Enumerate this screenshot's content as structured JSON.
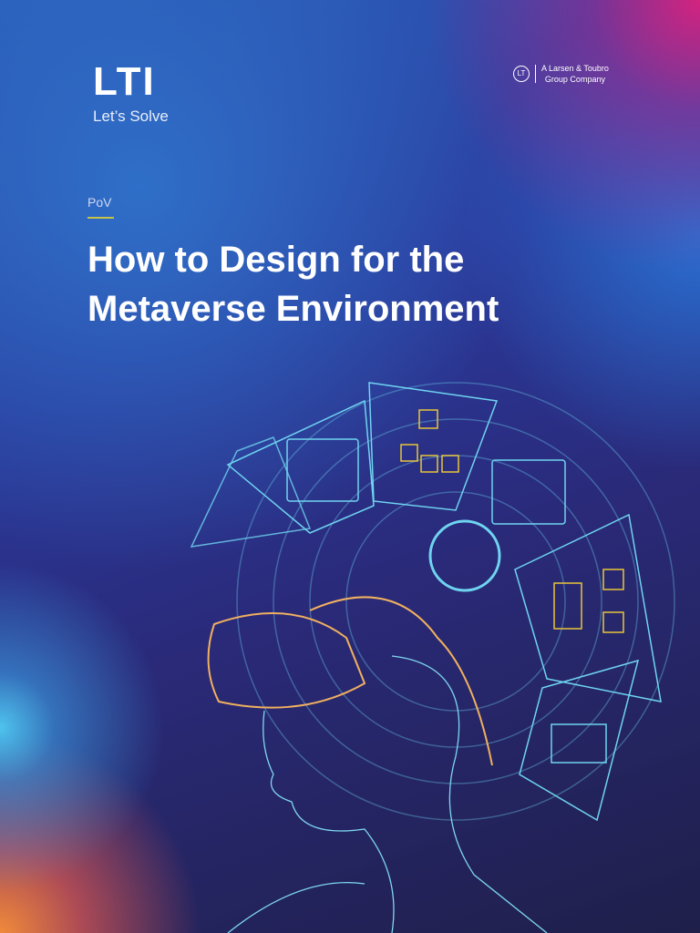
{
  "brand": {
    "logo": "LTI",
    "tagline": "Let’s Solve"
  },
  "parent": {
    "line1": "A Larsen & Toubro",
    "line2": "Group Company",
    "mark": "LT"
  },
  "label": "PoV",
  "title": "How to Design for the Metaverse Environment",
  "colors": {
    "accent": "#c7c24a",
    "icon_yellow": "#e8c53a",
    "icon_cyan": "#6fd4f0"
  }
}
